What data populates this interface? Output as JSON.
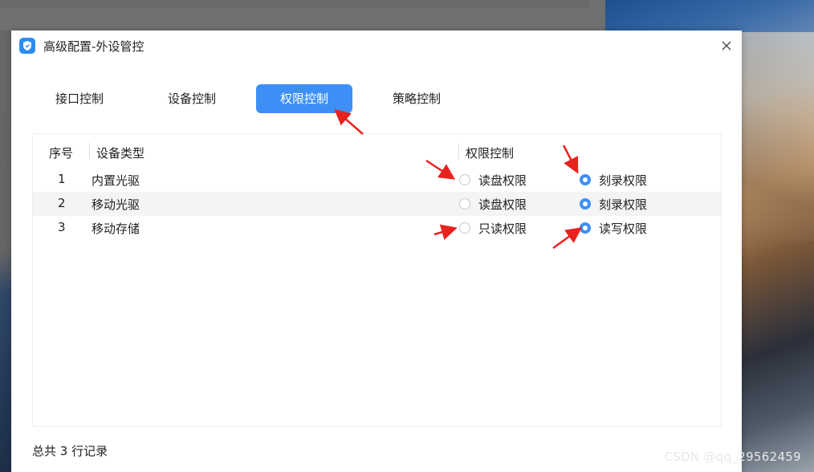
{
  "dialog": {
    "title": "高级配置-外设管控",
    "close_icon": "close-icon",
    "app_icon": "shield-icon"
  },
  "tabs": [
    {
      "label": "接口控制",
      "active": false
    },
    {
      "label": "设备控制",
      "active": false
    },
    {
      "label": "权限控制",
      "active": true
    },
    {
      "label": "策略控制",
      "active": false
    }
  ],
  "table": {
    "headers": {
      "index": "序号",
      "device_type": "设备类型",
      "permission": "权限控制"
    },
    "rows": [
      {
        "index": "1",
        "device": "内置光驱",
        "option_a": {
          "label": "读盘权限",
          "checked": false
        },
        "option_b": {
          "label": "刻录权限",
          "checked": true
        }
      },
      {
        "index": "2",
        "device": "移动光驱",
        "option_a": {
          "label": "读盘权限",
          "checked": false
        },
        "option_b": {
          "label": "刻录权限",
          "checked": true
        }
      },
      {
        "index": "3",
        "device": "移动存储",
        "option_a": {
          "label": "只读权限",
          "checked": false
        },
        "option_b": {
          "label": "读写权限",
          "checked": true
        }
      }
    ]
  },
  "footer": {
    "record_count": "总共 3 行记录"
  },
  "watermark": "CSDN @qq_29562459",
  "colors": {
    "accent": "#3d8ff5",
    "annotation_arrow": "#e8231f"
  }
}
